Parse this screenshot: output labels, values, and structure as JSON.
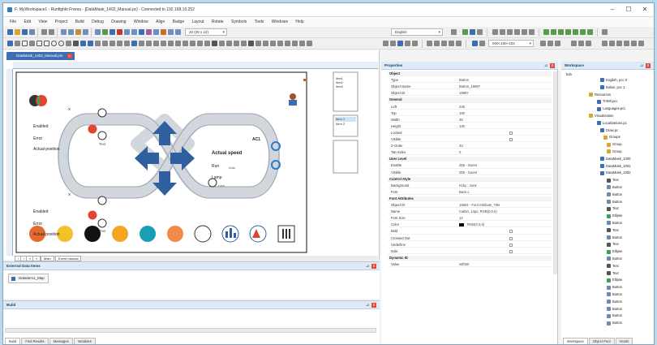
{
  "window": {
    "title": "F: MyWorkspace1 - Runfighkt Fnwou - [DataMask_1402_Manual.pc] - Connected to 192.168.10.252",
    "minimize": "–",
    "maximize": "☐",
    "close": "✕"
  },
  "menu": [
    "File",
    "Edit",
    "View",
    "Project",
    "Build",
    "Debug",
    "Drawing",
    "Window",
    "Align",
    "Badge",
    "Layout",
    "Rotate",
    "Symbols",
    "Tools",
    "Windows",
    "Help"
  ],
  "toolbar": {
    "zoom_combo": "20 (25 x 22)",
    "language_combo": "English",
    "style_combo": "000+100+102"
  },
  "editor": {
    "document_tab": "DataMask_1402_Manual.pm",
    "document_tab_close": "x",
    "labels": {
      "enabled_top": "Enabled",
      "error_top": "Error",
      "actual_position_top": "Actual position",
      "text_top": "Text",
      "enabled_bottom": "Enabled",
      "error_bottom": "Error",
      "actual_position_bottom": "Actual position",
      "text_bottom": "Text",
      "actual_speed": "Actual speed",
      "run": "Run",
      "auto": "Auto",
      "lamp": "Lamp",
      "lamp_value": "Lam",
      "ac": "AC1",
      "x_top": "X",
      "x_bottom": "X"
    },
    "list_items": [
      "Item1",
      "Item2",
      "Item3"
    ],
    "small_list": [
      "Item 1",
      "Item 2"
    ],
    "page_tabs": [
      "Main",
      "Event manual"
    ],
    "page_nav": [
      "‹",
      "›",
      "«",
      "»"
    ]
  },
  "colors": {
    "arrow_blue": "#2f5f9e",
    "refresh_blue": "#2a7bd1",
    "red_badge": "#e2452f",
    "toolbar_accent": "#3c6eb4"
  },
  "external_data": {
    "title": "External Data Items",
    "item": "Dataitem1_Map"
  },
  "build": {
    "title": "Build",
    "tabs": [
      "Build",
      "Find Results",
      "Messages",
      "Variables"
    ]
  },
  "properties": {
    "title": "Properties",
    "rows": [
      {
        "cat": true,
        "key": "Object"
      },
      {
        "key": "Type",
        "value": "Button"
      },
      {
        "key": "Object Name",
        "value": "Button_19897"
      },
      {
        "key": "Object ID",
        "value": "19897"
      },
      {
        "cat": true,
        "key": "General"
      },
      {
        "key": "Left",
        "value": "246"
      },
      {
        "key": "Top",
        "value": "190"
      },
      {
        "key": "Width",
        "value": "38"
      },
      {
        "key": "Height",
        "value": "130"
      },
      {
        "key": "Locked",
        "value": "",
        "check": true
      },
      {
        "key": "Visible",
        "value": "",
        "check": true
      },
      {
        "key": "Z-Order",
        "value": "33"
      },
      {
        "key": "Tab Index",
        "value": "0"
      },
      {
        "cat": true,
        "key": "User Level"
      },
      {
        "key": "Enable",
        "value": "255 - Guest"
      },
      {
        "key": "Visible",
        "value": "255 - Guest"
      },
      {
        "cat": true,
        "key": "Control Style"
      },
      {
        "key": "Background",
        "value": "Kcky : none"
      },
      {
        "key": "Font",
        "value": "Back L"
      },
      {
        "cat": true,
        "key": "Font Attributes"
      },
      {
        "key": "Object ID",
        "value": "16602 - Font Attribute_Title"
      },
      {
        "key": "Name",
        "value": "Calibri, 14px, RGB(0,0,0)"
      },
      {
        "key": "Font Size",
        "value": "14"
      },
      {
        "key": "Color",
        "value": "RGB(0,0,0)",
        "swatch": true
      },
      {
        "key": "Bold",
        "value": "",
        "check": true
      },
      {
        "key": "Crossed Out",
        "value": "",
        "check": true
      },
      {
        "key": "Underline",
        "value": "",
        "check": true
      },
      {
        "key": "Italic",
        "value": "",
        "check": true
      },
      {
        "cat": true,
        "key": "Dynamic ID"
      },
      {
        "key": "Value",
        "value": "ssf000"
      }
    ]
  },
  "workspace": {
    "title": "Workspace",
    "root": "bdn",
    "items": [
      "English, pcc 0",
      "Italian, pcc 1",
      "Resources",
      "Tr4Mt.pcc",
      "Languages.pcc",
      "Visualization",
      "Localizations.pc",
      "Draw.pc",
      "Groups",
      "Group",
      "Group",
      "DataMask_1000",
      "DataMask_1001",
      "DataMask_1002",
      "Text",
      "Button",
      "Button",
      "Button",
      "Text",
      "Ellipse",
      "Button",
      "Text",
      "Button",
      "Text",
      "Ellipse",
      "Button",
      "Text",
      "Text",
      "Ellipse",
      "Button",
      "Button",
      "Button",
      "Button",
      "Button",
      "Button"
    ],
    "tabs": [
      "Workspace",
      "Object Pool",
      "Vtools"
    ]
  }
}
